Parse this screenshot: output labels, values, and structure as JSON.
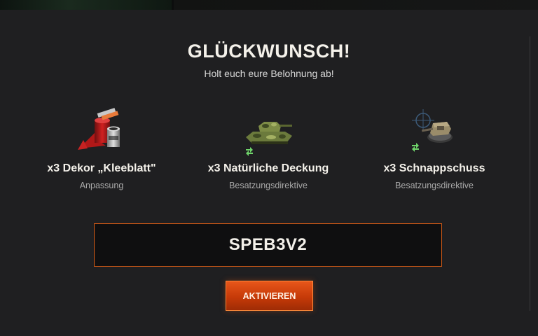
{
  "header": {
    "title": "GLÜCKWUNSCH!",
    "subtitle": "Holt euch eure Belohnung ab!"
  },
  "rewards": [
    {
      "name": "x3 Dekor „Kleeblatt\"",
      "type": "Anpassung",
      "icon": "paint-bucket-icon"
    },
    {
      "name": "x3 Natürliche Deckung",
      "type": "Besatzungsdirektive",
      "icon": "camo-tank-icon"
    },
    {
      "name": "x3 Schnappschuss",
      "type": "Besatzungsdirektive",
      "icon": "turret-crosshair-icon"
    }
  ],
  "code": {
    "value": "SPEB3V2"
  },
  "actions": {
    "activate_label": "AKTIVIEREN"
  },
  "colors": {
    "background": "#1f1f21",
    "accent": "#d15a16",
    "button": "#c63a08",
    "text": "#f4f1ea",
    "muted_text": "#a9a9a9",
    "green_badge": "#6fd36a"
  }
}
